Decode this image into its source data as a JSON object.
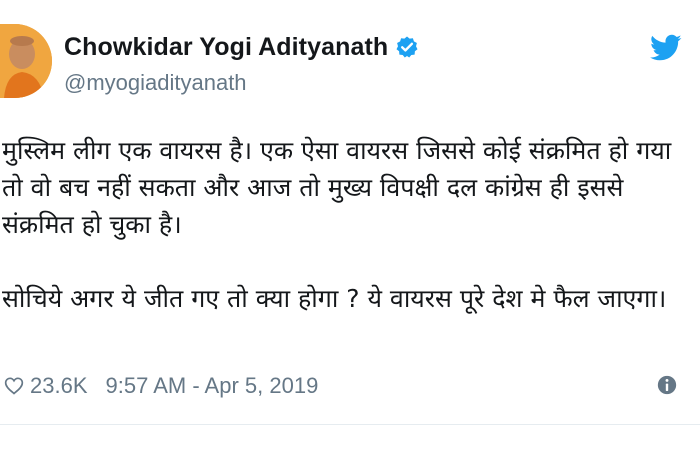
{
  "tweet": {
    "author": {
      "display_name": "Chowkidar Yogi Adityanath",
      "handle": "@myogiadityanath",
      "verified": true,
      "avatar_icon": "profile-photo"
    },
    "brand": {
      "icon": "twitter-bird-icon",
      "color": "#1da1f2"
    },
    "text": {
      "paragraph_1": [
        "मुस्लिम लीग एक वायरस है। एक ऐसा वायरस जिससे कोई संक्रमित हो गया",
        "तो वो बच नहीं सकता और आज तो मुख्य विपक्षी दल कांग्रेस ही इससे",
        "संक्रमित हो चुका है।"
      ],
      "paragraph_2": [
        "सोचिये अगर ये जीत गए तो क्या होगा ? ये वायरस पूरे देश मे फैल जाएगा।"
      ]
    },
    "footer": {
      "like_icon": "heart-icon",
      "like_count": "23.6K",
      "timestamp": "9:57 AM - Apr 5, 2019",
      "info_icon": "info-icon"
    },
    "colors": {
      "text": "#14171a",
      "secondary": "#657786",
      "verified": "#1da1f2",
      "avatar_background": "#f0a640"
    }
  }
}
